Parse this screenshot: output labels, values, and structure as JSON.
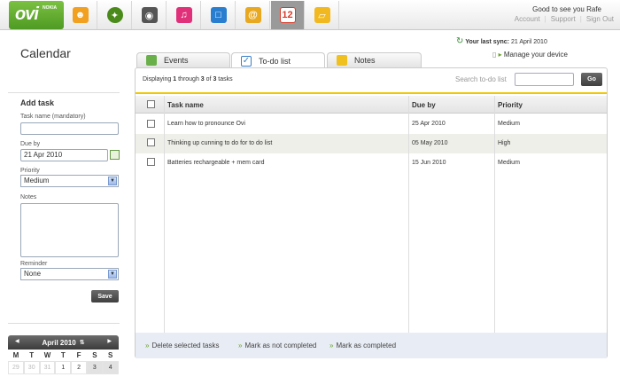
{
  "header": {
    "logo_text": "ovi",
    "logo_brand": "NOKIA",
    "greeting": "Good to see you  Rafe",
    "links": [
      "Account",
      "Support",
      "Sign Out"
    ],
    "app_icons": [
      {
        "name": "contacts-icon",
        "color": "#f1a020"
      },
      {
        "name": "maps-icon",
        "color": "#4a8a1a"
      },
      {
        "name": "photos-icon",
        "color": "#555555"
      },
      {
        "name": "music-icon",
        "color": "#e0307a"
      },
      {
        "name": "store-icon",
        "color": "#2a7ed0"
      },
      {
        "name": "mail-icon",
        "color": "#e8a820"
      },
      {
        "name": "calendar-icon",
        "color": "#d83a2a",
        "text": "12"
      },
      {
        "name": "files-icon",
        "color": "#f2b820"
      }
    ]
  },
  "page": {
    "title": "Calendar"
  },
  "sync": {
    "label": "Your last sync:",
    "date": "21 April 2010",
    "manage": "Manage your device"
  },
  "add_task": {
    "heading": "Add task",
    "task_name_label": "Task name (mandatory)",
    "task_name_value": "",
    "due_label": "Due by",
    "due_value": "21 Apr  2010",
    "priority_label": "Priority",
    "priority_value": "Medium",
    "notes_label": "Notes",
    "reminder_label": "Reminder",
    "reminder_value": "None",
    "save_label": "Save"
  },
  "calendar": {
    "month": "April 2010",
    "weekdays": [
      "M",
      "T",
      "W",
      "T",
      "F",
      "S",
      "S"
    ],
    "first_row": [
      "29",
      "30",
      "31",
      "1",
      "2",
      "3",
      "4"
    ]
  },
  "tabs": [
    {
      "label": "Events",
      "color": "#6ab04a"
    },
    {
      "label": "To-do list",
      "color": "#3a7fc8"
    },
    {
      "label": "Notes",
      "color": "#f0c020"
    }
  ],
  "list": {
    "info_prefix": "Displaying ",
    "info_from": "1",
    "info_mid": " through ",
    "info_to": "3",
    "info_of": " of ",
    "info_total": "3",
    "info_suffix": " tasks",
    "search_placeholder": "Search to-do list",
    "go_label": "Go",
    "columns": [
      "Task name",
      "Due by",
      "Priority"
    ],
    "rows": [
      {
        "task": "Learn how to pronounce Ovi",
        "due": "25 Apr 2010",
        "priority": "Medium"
      },
      {
        "task": "Thinking up cunning to do for to do list",
        "due": "05 May 2010",
        "priority": "High"
      },
      {
        "task": "Batteries rechargeable + mem card",
        "due": "15 Jun 2010",
        "priority": "Medium"
      }
    ],
    "actions": [
      "Delete selected tasks",
      "Mark as not completed",
      "Mark as completed"
    ]
  }
}
